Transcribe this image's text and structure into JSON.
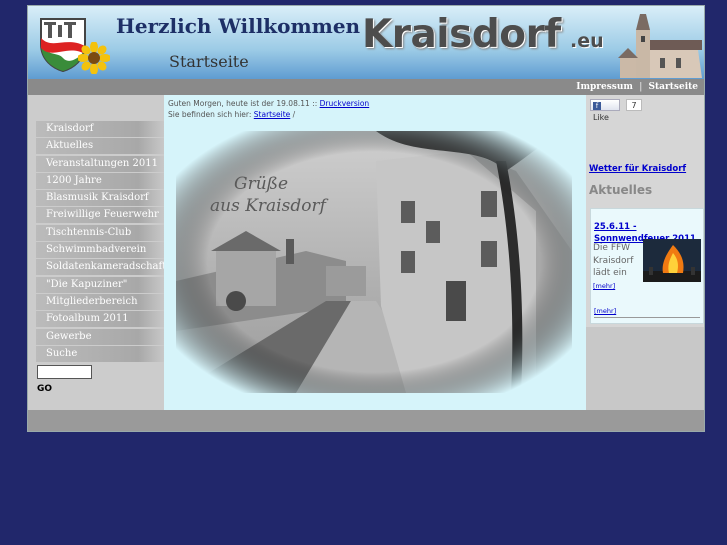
{
  "header": {
    "welcome": "Herzlich Willkommen",
    "subtitle": "Startseite",
    "sitename": "Kraisdorf",
    "sitename_suffix": ".eu"
  },
  "topbar": {
    "impressum": "Impressum",
    "separator": "|",
    "startseite": "Startseite"
  },
  "status": {
    "greeting": "Guten Morgen, heute ist der 19.08.11 ::",
    "print_link": "Druckversion",
    "crumb_label": "Sie befinden sich hier:",
    "crumb_link": "Startseite",
    "crumb_tail": "/"
  },
  "menu": {
    "items": [
      {
        "label": "Kraisdorf"
      },
      {
        "label": "Aktuelles"
      },
      {
        "label": "Veranstaltungen 2011"
      },
      {
        "label": "1200 Jahre"
      },
      {
        "label": "Blasmusik Kraisdorf"
      },
      {
        "label": "Freiwillige Feuerwehr"
      },
      {
        "label": "Tischtennis-Club"
      },
      {
        "label": "Schwimmbadverein"
      },
      {
        "label": "Soldatenkameradschaft"
      },
      {
        "label": "\"Die Kapuziner\""
      },
      {
        "label": "Mitgliederbereich"
      },
      {
        "label": "Fotoalbum 2011"
      },
      {
        "label": "Gewerbe"
      },
      {
        "label": "Suche"
      }
    ]
  },
  "search": {
    "value": "",
    "go_label": "GO"
  },
  "photo": {
    "caption_line1": "Grüße",
    "caption_line2": "aus Kraisdorf"
  },
  "sidebar": {
    "like_label": "Like",
    "like_count": "7",
    "weather_link": "Wetter für Kraisdorf",
    "news_heading": "Aktuelles",
    "news_title": "25.6.11 - Sonnwendfeuer 2011",
    "news_text": "Die FFW Kraisdorf lädt ein",
    "news_more": "[mehr]",
    "news_more2": "[mehr]"
  },
  "colors": {
    "background": "#21276b",
    "content_bg": "#d6f4fa",
    "link": "#0000cc"
  }
}
